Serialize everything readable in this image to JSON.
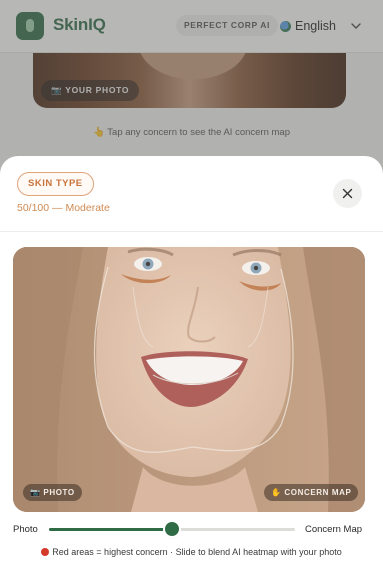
{
  "header": {
    "brand": "SkinIQ",
    "partner_badge": "PERFECT CORP AI",
    "language": "English"
  },
  "background": {
    "photo_chip": "YOUR PHOTO",
    "tap_hint": "Tap any concern to see the AI concern map"
  },
  "sheet": {
    "concern_label": "SKIN TYPE",
    "score_text": "50/100 — Moderate",
    "photo_chip": "PHOTO",
    "map_chip": "CONCERN MAP",
    "slider": {
      "left_label": "Photo",
      "right_label": "Concern Map",
      "value_percent": 50
    },
    "legend": "Red areas = highest concern · Slide to blend AI heatmap with your photo"
  },
  "colors": {
    "brand_green": "#2f6b45",
    "accent_orange": "#d08a52",
    "concern_red": "#d43a2a"
  }
}
